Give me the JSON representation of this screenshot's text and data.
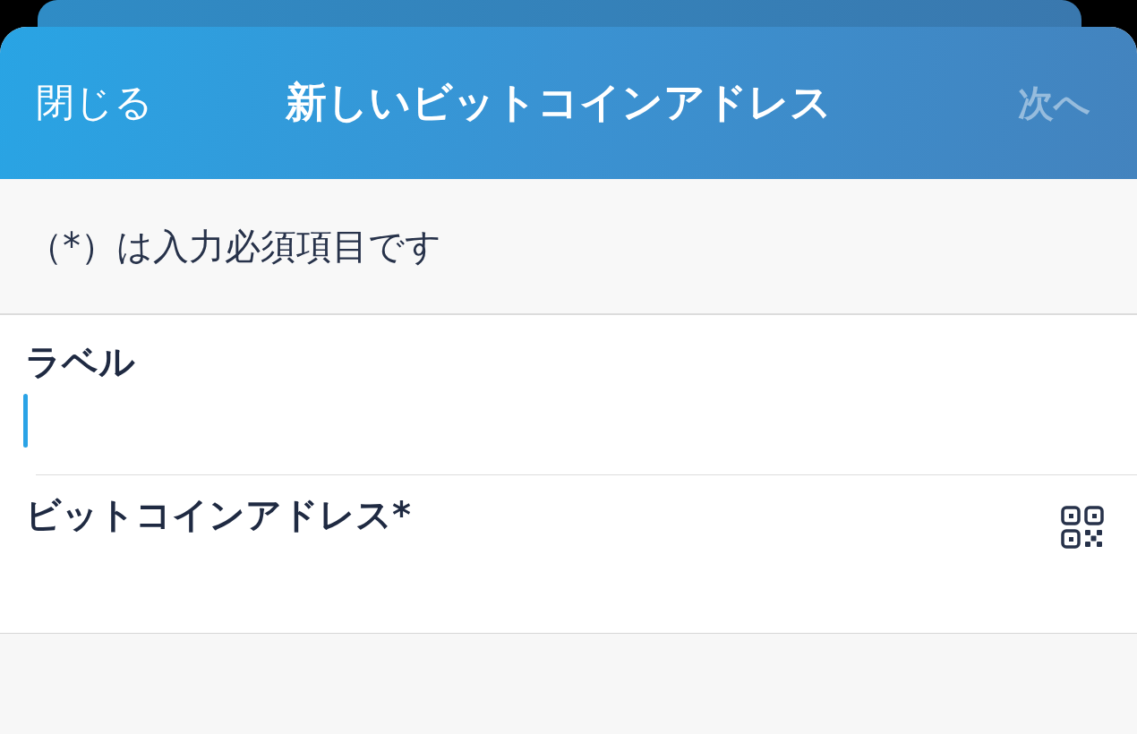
{
  "header": {
    "close_label": "閉じる",
    "title": "新しいビットコインアドレス",
    "next": {
      "label": "次へ",
      "disabled": true
    }
  },
  "note": "（*）は入力必須項目です",
  "fields": [
    {
      "kind": "text",
      "label": "ラベル",
      "focused": true
    },
    {
      "kind": "address",
      "label": "ビットコインアドレス*",
      "focused": false
    }
  ]
}
